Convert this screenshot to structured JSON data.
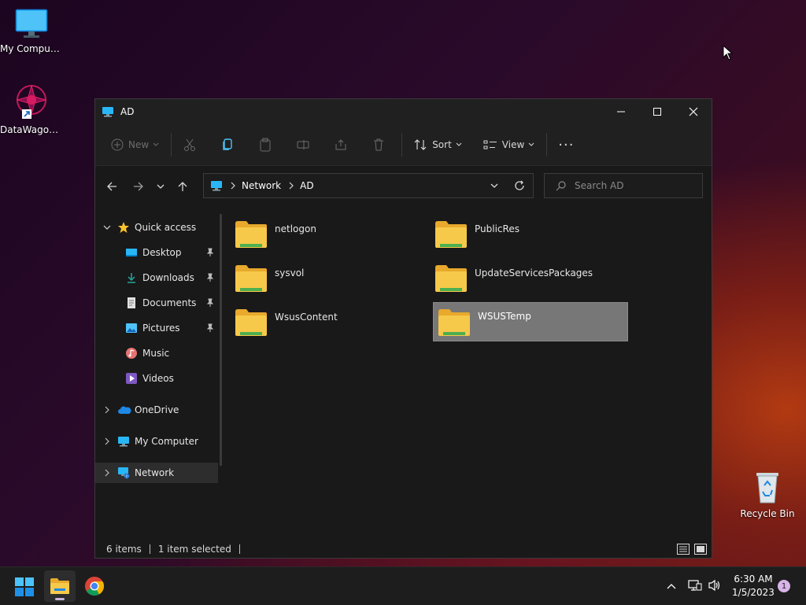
{
  "desktop": {
    "icons": [
      {
        "label": "My Computer",
        "icon": "monitor-icon"
      },
      {
        "label": "DataWagon...",
        "icon": "datawagon-shortcut-icon"
      },
      {
        "label": "Recycle Bin",
        "icon": "recycle-bin-icon"
      }
    ]
  },
  "window": {
    "title": "AD",
    "toolbar": {
      "new_label": "New",
      "sort_label": "Sort",
      "view_label": "View",
      "more_label": "···"
    },
    "address": {
      "segments": [
        "Network",
        "AD"
      ]
    },
    "search": {
      "placeholder": "Search AD"
    },
    "sidebar": {
      "quick_access": "Quick access",
      "items": [
        {
          "label": "Desktop",
          "icon": "desktop-icon",
          "pinned": true
        },
        {
          "label": "Downloads",
          "icon": "download-icon",
          "pinned": true
        },
        {
          "label": "Documents",
          "icon": "document-icon",
          "pinned": true
        },
        {
          "label": "Pictures",
          "icon": "pictures-icon",
          "pinned": true
        },
        {
          "label": "Music",
          "icon": "music-icon",
          "pinned": false
        },
        {
          "label": "Videos",
          "icon": "video-icon",
          "pinned": false
        }
      ],
      "onedrive": "OneDrive",
      "my_computer": "My Computer",
      "network": "Network"
    },
    "folders": [
      {
        "name": "netlogon"
      },
      {
        "name": "PublicRes"
      },
      {
        "name": "sysvol"
      },
      {
        "name": "UpdateServicesPackages"
      },
      {
        "name": "WsusContent"
      },
      {
        "name": "WSUSTemp"
      }
    ],
    "status": {
      "count": "6 items",
      "selection": "1 item selected"
    }
  },
  "taskbar": {
    "time": "6:30 AM",
    "date": "1/5/2023",
    "notification_count": "1"
  },
  "colors": {
    "accent": "#0078d4",
    "folder_yellow": "#f6c94a",
    "folder_green": "#4caf50"
  }
}
